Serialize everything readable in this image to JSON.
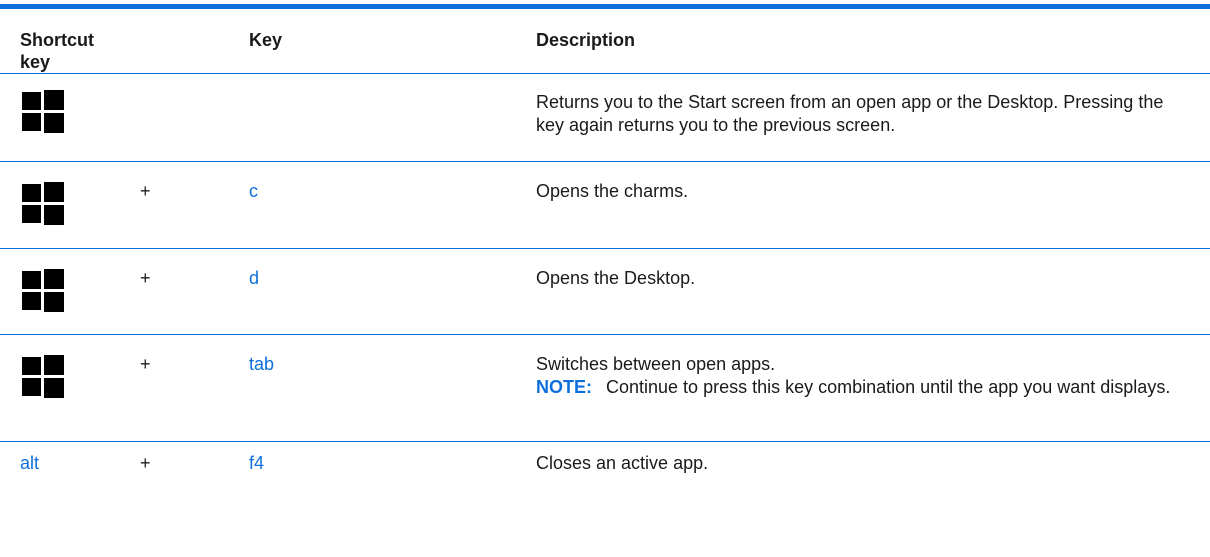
{
  "table": {
    "headers": {
      "shortcut_key": "Shortcut key",
      "key": "Key",
      "description": "Description"
    },
    "rows": [
      {
        "shortcut_icon": "windows-logo-icon",
        "plus": "",
        "key": "",
        "description": "Returns you to the Start screen from an open app or the Desktop. Pressing the key again returns you to the previous screen."
      },
      {
        "shortcut_icon": "windows-logo-icon",
        "plus": "+",
        "key": "c",
        "description": "Opens the charms."
      },
      {
        "shortcut_icon": "windows-logo-icon",
        "plus": "+",
        "key": "d",
        "description": "Opens the Desktop."
      },
      {
        "shortcut_icon": "windows-logo-icon",
        "plus": "+",
        "key": "tab",
        "description": "Switches between open apps.",
        "note_label": "NOTE:",
        "note_text": "Continue to press this key combination until the app you want displays."
      },
      {
        "shortcut_text": "alt",
        "plus": "+",
        "key": "f4",
        "description": "Closes an active app."
      }
    ]
  },
  "colors": {
    "accent": "#0c6fdc",
    "text": "#1a1a1a"
  }
}
